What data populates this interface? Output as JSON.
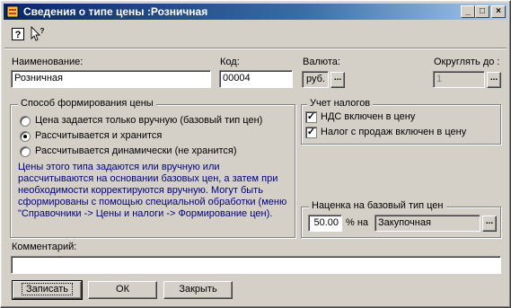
{
  "window": {
    "title": "Сведения о типе цены :Розничная"
  },
  "titlebar_buttons": {
    "minimize": "_",
    "maximize": "□",
    "close": "×"
  },
  "toolbar": {
    "help_icon": "help-icon",
    "whatsthis_icon": "whats-this-icon"
  },
  "form": {
    "name_label": "Наименование:",
    "name_value": "Розничная",
    "code_label": "Код:",
    "code_value": "00004",
    "currency_label": "Валюта:",
    "currency_value": "руб.",
    "round_label": "Округлять до :",
    "round_value": "1",
    "ellipsis": "..."
  },
  "pricing_method": {
    "title": "Способ формирования цены",
    "options": [
      "Цена задается только вручную (базовый тип цен)",
      "Рассчитывается и хранится",
      "Рассчитывается динамически (не хранится)"
    ],
    "selected_index": 1,
    "description": "Цены этого типа задаются или вручную или рассчитываются на основании базовых цен, а затем при необходимости корректируются вручную. Могут быть сформированы с помощью специальной обработки (меню \"Справочники -> Цены и налоги -> Формирование цен)."
  },
  "taxes": {
    "title": "Учет налогов",
    "vat": "НДС включен в цену",
    "vat_checked": true,
    "sales_tax": "Налог с продаж включен в цену",
    "sales_tax_checked": true
  },
  "markup": {
    "title": "Наценка на базовый тип цен",
    "value": "50.00",
    "unit": "% на",
    "base_type": "Закупочная"
  },
  "comment": {
    "label": "Комментарий:",
    "value": ""
  },
  "buttons": {
    "save": "Записать",
    "ok": "ОК",
    "close": "Закрыть"
  }
}
